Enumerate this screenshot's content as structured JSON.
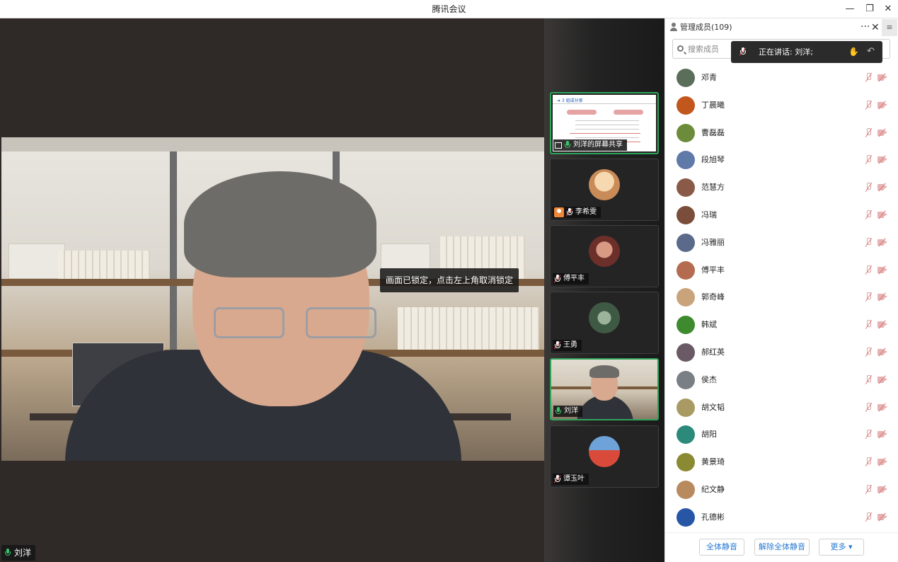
{
  "window": {
    "title": "腾讯会议",
    "minimize": "—",
    "restore": "❐",
    "close": "✕"
  },
  "stage": {
    "lock_toast": "画面已锁定，点击左上角取消锁定",
    "speaker_name": "刘洋"
  },
  "thumbnails": [
    {
      "name": "刘洋的屏幕共享",
      "type": "screen-share",
      "doc_header": "➜ 3 组成分享",
      "mic": "on",
      "active": true
    },
    {
      "name": "李希雯",
      "type": "participant",
      "mic": "muted",
      "badge": "host-icon",
      "avatar_color": "#e8b98a"
    },
    {
      "name": "傅平丰",
      "type": "participant",
      "mic": "muted",
      "avatar_color": "#c96e5a"
    },
    {
      "name": "王勇",
      "type": "participant",
      "mic": "muted",
      "avatar_color": "#6a7f6b"
    },
    {
      "name": "刘洋",
      "type": "participant-video",
      "mic": "on",
      "active": true
    },
    {
      "name": "谭玉叶",
      "type": "participant",
      "mic": "muted",
      "avatar_color": "#c8553d"
    }
  ],
  "sidebar": {
    "title": "管理成员(109)",
    "more": "···",
    "close": "✕",
    "menu": "≡",
    "search_placeholder": "搜索成员",
    "speaking": "正在讲话: 刘洋;",
    "members": [
      {
        "name": "邓青",
        "avatar_color": "#5b6e5a"
      },
      {
        "name": "丁晨曦",
        "avatar_color": "#c2571d"
      },
      {
        "name": "曹磊磊",
        "avatar_color": "#6d8c3b"
      },
      {
        "name": "段旭琴",
        "avatar_color": "#5f79a8"
      },
      {
        "name": "范慧方",
        "avatar_color": "#8a5a48"
      },
      {
        "name": "冯瑞",
        "avatar_color": "#7a4e3a"
      },
      {
        "name": "冯雅丽",
        "avatar_color": "#5b6a8a"
      },
      {
        "name": "傅平丰",
        "avatar_color": "#b56b4f"
      },
      {
        "name": "郭奇峰",
        "avatar_color": "#c9a37a"
      },
      {
        "name": "韩斌",
        "avatar_color": "#3e8a2e"
      },
      {
        "name": "郝红英",
        "avatar_color": "#6a5a66"
      },
      {
        "name": "侯杰",
        "avatar_color": "#7a7f86"
      },
      {
        "name": "胡文韬",
        "avatar_color": "#a89a62"
      },
      {
        "name": "胡阳",
        "avatar_color": "#2b8a7a"
      },
      {
        "name": "黄景琦",
        "avatar_color": "#8a8a32"
      },
      {
        "name": "纪文静",
        "avatar_color": "#b88a5e"
      },
      {
        "name": "孔德彬",
        "avatar_color": "#2856a6"
      }
    ],
    "footer": {
      "mute_all": "全体静音",
      "unmute_all": "解除全体静音",
      "more": "更多 ▾"
    }
  },
  "colors": {
    "accent_green": "#2fa35a",
    "link_blue": "#2a7ad2",
    "stage_bg": "#2f2a28"
  }
}
